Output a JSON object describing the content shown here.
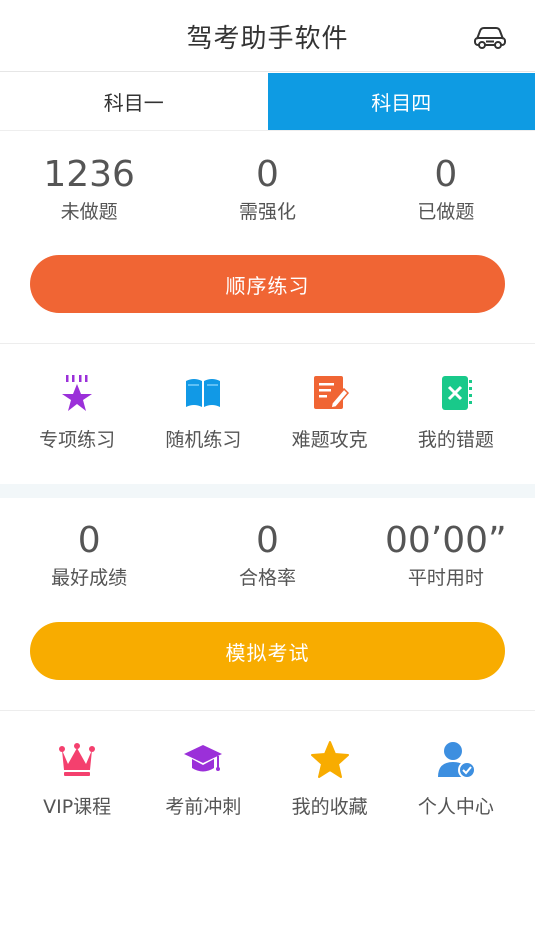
{
  "header": {
    "title": "驾考助手软件",
    "car_icon": "car-icon"
  },
  "tabs": [
    {
      "label": "科目一",
      "active": false
    },
    {
      "label": "科目四",
      "active": true
    }
  ],
  "practice_stats": [
    {
      "value": "1236",
      "label": "未做题"
    },
    {
      "value": "0",
      "label": "需强化"
    },
    {
      "value": "0",
      "label": "已做题"
    }
  ],
  "practice_button": {
    "label": "顺序练习",
    "color": "#f06534"
  },
  "practice_modes": [
    {
      "label": "专项练习",
      "icon": "star-icon",
      "color": "#9b30d9"
    },
    {
      "label": "随机练习",
      "icon": "book-icon",
      "color": "#1199e6"
    },
    {
      "label": "难题攻克",
      "icon": "edit-icon",
      "color": "#f06534"
    },
    {
      "label": "我的错题",
      "icon": "error-notebook-icon",
      "color": "#19c98a"
    }
  ],
  "exam_stats": [
    {
      "value": "0",
      "label": "最好成绩"
    },
    {
      "value": "0",
      "label": "合格率"
    },
    {
      "value": "00’00”",
      "label": "平时用时"
    }
  ],
  "exam_button": {
    "label": "模拟考试",
    "color": "#f8ac00"
  },
  "more": [
    {
      "label": "VIP课程",
      "icon": "crown-icon",
      "color": "#f4406e"
    },
    {
      "label": "考前冲刺",
      "icon": "graduation-cap-icon",
      "color": "#9b30d9"
    },
    {
      "label": "我的收藏",
      "icon": "star-icon",
      "color": "#f8ac00"
    },
    {
      "label": "个人中心",
      "icon": "user-icon",
      "color": "#3d8fe0"
    }
  ]
}
